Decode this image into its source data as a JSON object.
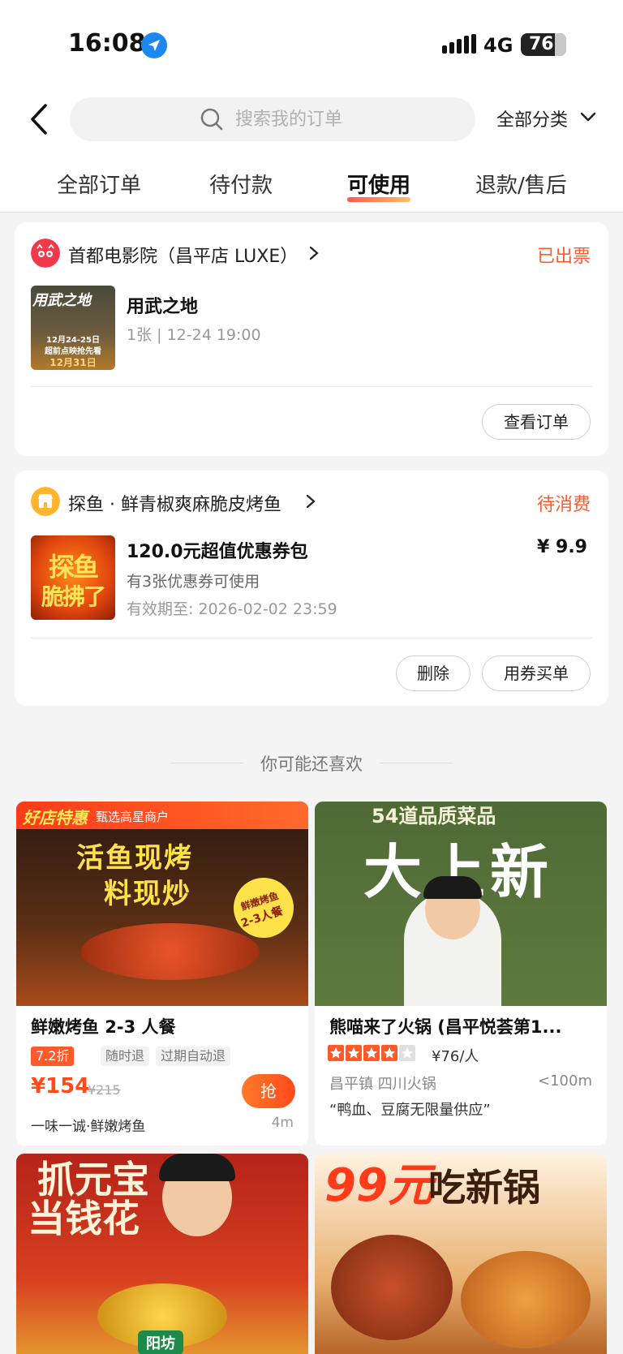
{
  "status_bar": {
    "time": "16:08",
    "network": "4G",
    "battery": "76"
  },
  "nav": {
    "search_placeholder": "搜索我的订单",
    "category_label": "全部分类"
  },
  "tabs": [
    {
      "label": "全部订单",
      "active": false
    },
    {
      "label": "待付款",
      "active": false
    },
    {
      "label": "可使用",
      "active": true
    },
    {
      "label": "退款/售后",
      "active": false
    }
  ],
  "orders": [
    {
      "shop": "首都电影院（昌平店 LUXE）",
      "status": "已出票",
      "title": "用武之地",
      "line1": "1张 | 12-24 19:00",
      "thumb_text": [
        "用武之地",
        "12月24-25日",
        "超前点映抢先看",
        "12月31日"
      ],
      "buttons": [
        "查看订单"
      ]
    },
    {
      "shop": "探鱼 · 鲜青椒爽麻脆皮烤鱼",
      "status": "待消费",
      "title": "120.0元超值优惠券包",
      "price": "¥ 9.9",
      "line1": "有3张优惠券可使用",
      "line2": "有效期至: 2026-02-02 23:59",
      "thumb_text": [
        "探鱼",
        "脆拂了"
      ],
      "buttons": [
        "删除",
        "用券买单"
      ]
    }
  ],
  "recommend": {
    "heading": "你可能还喜欢",
    "items": [
      {
        "badge": "好店特惠",
        "badge_sub": "甄选高星商户",
        "img_text": [
          "活鱼现烤",
          "料现炒",
          "鲜嫩烤鱼",
          "2-3人餐"
        ],
        "title": "鲜嫩烤鱼 2-3 人餐",
        "tags": [
          "7.2折",
          "随时退",
          "过期自动退"
        ],
        "price": "¥154",
        "orig_price": "¥215",
        "grab": "抢",
        "shop": "一味一诚·鲜嫩烤鱼",
        "distance": "4m"
      },
      {
        "img_text": [
          "54道品质菜品",
          "大上新"
        ],
        "title": "熊喵来了火锅 (昌平悦荟第1...",
        "rating": 4,
        "avg_price": "¥76/人",
        "area": "昌平镇 四川火锅",
        "distance": "<100m",
        "quote": "“鸭血、豆腐无限量供应”"
      },
      {
        "img_text": [
          "抓元宝",
          "当钱花",
          "阳坊"
        ]
      },
      {
        "img_text": [
          "99元",
          "吃新锅"
        ]
      }
    ]
  },
  "colors": {
    "accent": "#ff5a2a",
    "price": "#ff4a1a",
    "location": "#1e88f0"
  }
}
